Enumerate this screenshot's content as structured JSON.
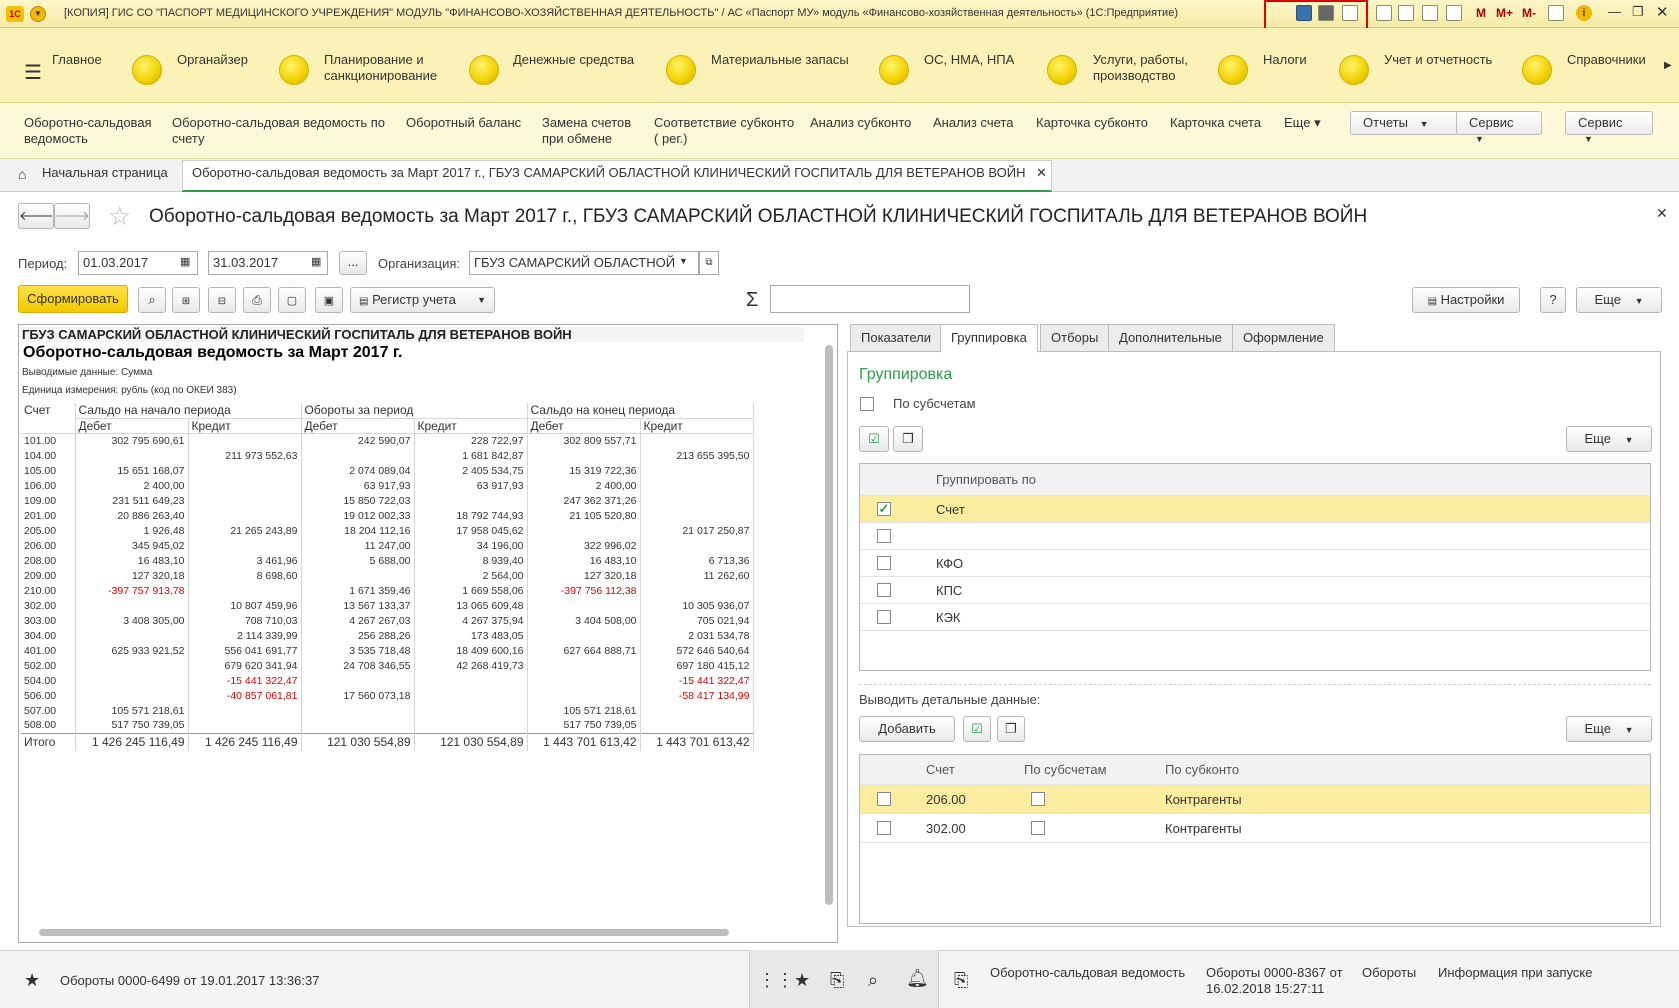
{
  "window": {
    "title": "[КОПИЯ] ГИС СО \"ПАСПОРТ МЕДИЦИНСКОГО УЧРЕЖДЕНИЯ\" МОДУЛЬ \"ФИНАНСОВО-ХОЗЯЙСТВЕННАЯ ДЕЯТЕЛЬНОСТЬ\" / АС «Паспорт МУ» модуль «Финансово-хозяйственная деятельность» (1С:Предприятие)",
    "m_labels": [
      "M",
      "M+",
      "M-"
    ]
  },
  "sections": [
    {
      "label": "Главное"
    },
    {
      "label": "Органайзер"
    },
    {
      "label": "Планирование и\nсанкционирование"
    },
    {
      "label": "Денежные средства"
    },
    {
      "label": "Материальные запасы"
    },
    {
      "label": "ОС, НМА, НПА"
    },
    {
      "label": "Услуги, работы,\nпроизводство"
    },
    {
      "label": "Налоги"
    },
    {
      "label": "Учет и отчетность"
    },
    {
      "label": "Справочники"
    }
  ],
  "commands": [
    "Оборотно-сальдовая\nведомость",
    "Оборотно-сальдовая ведомость по\nсчету",
    "Оборотный баланс",
    "Замена счетов\nпри обмене",
    "Соответствие субконто\n( рег.)",
    "Анализ субконто",
    "Анализ счета",
    "Карточка субконто",
    "Карточка счета",
    "Еще"
  ],
  "command_buttons": [
    "Отчеты",
    "Сервис",
    "Сервис"
  ],
  "tabs": {
    "home": "Начальная страница",
    "active": "Оборотно-сальдовая ведомость за Март 2017 г., ГБУЗ САМАРСКИЙ ОБЛАСТНОЙ КЛИНИЧЕСКИЙ ГОСПИТАЛЬ ДЛЯ ВЕТЕРАНОВ ВОЙН"
  },
  "form": {
    "title": "Оборотно-сальдовая ведомость за Март 2017 г., ГБУЗ САМАРСКИЙ ОБЛАСТНОЙ КЛИНИЧЕСКИЙ ГОСПИТАЛЬ ДЛЯ ВЕТЕРАНОВ ВОЙН",
    "period_label": "Период:",
    "date_from": "01.03.2017",
    "date_to": "31.03.2017",
    "ellipsis": "...",
    "org_label": "Организация:",
    "org_value": "ГБУЗ САМАРСКИЙ ОБЛАСТНОЙ",
    "generate": "Сформировать",
    "register": "Регистр учета",
    "sigma": "Σ",
    "settings": "Настройки",
    "help": "?",
    "more": "Еще"
  },
  "report": {
    "org": "ГБУЗ САМАРСКИЙ ОБЛАСТНОЙ КЛИНИЧЕСКИЙ ГОСПИТАЛЬ ДЛЯ ВЕТЕРАНОВ ВОЙН",
    "title": "Оборотно-сальдовая ведомость за Март 2017 г.",
    "data_shown": "Выводимые данные:  Сумма",
    "unit": "Единица измерения: рубль (код по ОКЕИ 383)",
    "head": {
      "account": "Счет",
      "opening": "Сальдо на начало периода",
      "turnover": "Обороты за период",
      "closing": "Сальдо на конец периода",
      "debit": "Дебет",
      "credit": "Кредит"
    },
    "rows": [
      [
        "101.00",
        "302 795 690,61",
        "",
        "242 590,07",
        "228 722,97",
        "302 809 557,71",
        ""
      ],
      [
        "104.00",
        "",
        "211 973 552,63",
        "",
        "1 681 842,87",
        "",
        "213 655 395,50"
      ],
      [
        "105.00",
        "15 651 168,07",
        "",
        "2 074 089,04",
        "2 405 534,75",
        "15 319 722,36",
        ""
      ],
      [
        "106.00",
        "2 400,00",
        "",
        "63 917,93",
        "63 917,93",
        "2 400,00",
        ""
      ],
      [
        "109.00",
        "231 511 649,23",
        "",
        "15 850 722,03",
        "",
        "247 362 371,26",
        ""
      ],
      [
        "201.00",
        "20 886 263,40",
        "",
        "19 012 002,33",
        "18 792 744,93",
        "21 105 520,80",
        ""
      ],
      [
        "205.00",
        "1 926,48",
        "21 265 243,89",
        "18 204 112,16",
        "17 958 045,62",
        "",
        "21 017 250,87"
      ],
      [
        "206.00",
        "345 945,02",
        "",
        "11 247,00",
        "34 196,00",
        "322 996,02",
        ""
      ],
      [
        "208.00",
        "16 483,10",
        "3 461,96",
        "5 688,00",
        "8 939,40",
        "16 483,10",
        "6 713,36"
      ],
      [
        "209.00",
        "127 320,18",
        "8 698,60",
        "",
        "2 564,00",
        "127 320,18",
        "11 262,60"
      ],
      [
        "210.00",
        "-397 757 913,78",
        "",
        "1 671 359,46",
        "1 669 558,06",
        "-397 756 112,38",
        ""
      ],
      [
        "302.00",
        "",
        "10 807 459,96",
        "13 567 133,37",
        "13 065 609,48",
        "",
        "10 305 936,07"
      ],
      [
        "303.00",
        "3 408 305,00",
        "708 710,03",
        "4 267 267,03",
        "4 267 375,94",
        "3 404 508,00",
        "705 021,94"
      ],
      [
        "304.00",
        "",
        "2 114 339,99",
        "256 288,26",
        "173 483,05",
        "",
        "2 031 534,78"
      ],
      [
        "401.00",
        "625 933 921,52",
        "556 041 691,77",
        "3 535 718,48",
        "18 409 600,16",
        "627 664 888,71",
        "572 646 540,64"
      ],
      [
        "502.00",
        "",
        "679 620 341,94",
        "24 708 346,55",
        "42 268 419,73",
        "",
        "697 180 415,12"
      ],
      [
        "504.00",
        "",
        "-15 441 322,47",
        "",
        "",
        "",
        "-15 441 322,47"
      ],
      [
        "506.00",
        "",
        "-40 857 061,81",
        "17 560 073,18",
        "",
        "",
        "-58 417 134,99"
      ],
      [
        "507.00",
        "105 571 218,61",
        "",
        "",
        "",
        "105 571 218,61",
        ""
      ],
      [
        "508.00",
        "517 750 739,05",
        "",
        "",
        "",
        "517 750 739,05",
        ""
      ]
    ],
    "total": [
      "Итого",
      "1 426 245 116,49",
      "1 426 245 116,49",
      "121 030 554,89",
      "121 030 554,89",
      "1 443 701 613,42",
      "1 443 701 613,42"
    ]
  },
  "settings_panel": {
    "tabs": [
      "Показатели",
      "Группировка",
      "Отборы",
      "Дополнительные",
      "Оформление"
    ],
    "heading": "Группировка",
    "by_subaccounts": "По субсчетам",
    "more": "Еще",
    "group_by_header": "Группировать по",
    "group_rows": [
      {
        "label": "Счет",
        "checked": true
      },
      {
        "label": "",
        "checked": false
      },
      {
        "label": "КФО",
        "checked": false
      },
      {
        "label": "КПС",
        "checked": false
      },
      {
        "label": "КЭК",
        "checked": false
      }
    ],
    "detail_label": "Выводить детальные данные:",
    "add": "Добавить",
    "detail_head": [
      "Счет",
      "По субсчетам",
      "По субконто"
    ],
    "detail_rows": [
      {
        "account": "206.00",
        "subconto": "Контрагенты"
      },
      {
        "account": "302.00",
        "subconto": "Контрагенты"
      }
    ]
  },
  "status": {
    "left": "Обороты 0000-6499 от 19.01.2017 13:36:37",
    "items": [
      "Оборотно-сальдовая ведомость",
      "Обороты 0000-8367 от\n16.02.2018 15:27:11",
      "Обороты",
      "Информация при запуске"
    ]
  }
}
